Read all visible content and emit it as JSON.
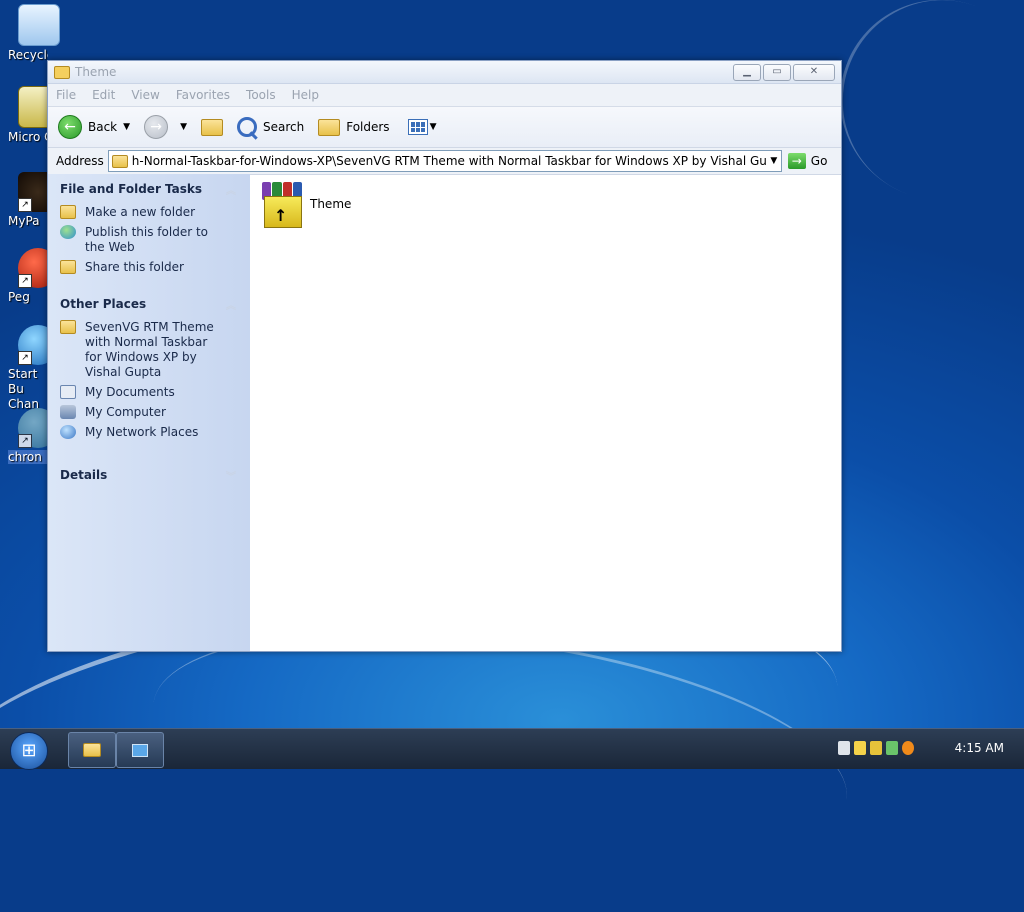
{
  "desktop": {
    "icons": [
      {
        "label": "Recycle Bin"
      },
      {
        "label": "Micro Outlo"
      },
      {
        "label": "MyPa"
      },
      {
        "label": "Peg"
      },
      {
        "label": "Start Bu Chan"
      },
      {
        "label": "chron"
      }
    ]
  },
  "window": {
    "title": "Theme",
    "menu": [
      "File",
      "Edit",
      "View",
      "Favorites",
      "Tools",
      "Help"
    ],
    "toolbar": {
      "back": "Back",
      "search": "Search",
      "folders": "Folders"
    },
    "address": {
      "label": "Address",
      "value": "h-Normal-Taskbar-for-Windows-XP\\SevenVG RTM Theme with Normal Taskbar for Windows XP by Vishal Gupta\\Theme",
      "go": "Go"
    },
    "tasks": {
      "file_folder": {
        "title": "File and Folder Tasks",
        "items": [
          "Make a new folder",
          "Publish this folder to the Web",
          "Share this folder"
        ]
      },
      "other_places": {
        "title": "Other Places",
        "items": [
          "SevenVG RTM Theme with Normal Taskbar for Windows XP by Vishal Gupta",
          "My Documents",
          "My Computer",
          "My Network Places"
        ]
      },
      "details": {
        "title": "Details"
      }
    },
    "files": [
      {
        "name": "Theme",
        "icon": "winrar-archive-icon"
      }
    ]
  },
  "taskbar": {
    "clock": "4:15 AM"
  }
}
